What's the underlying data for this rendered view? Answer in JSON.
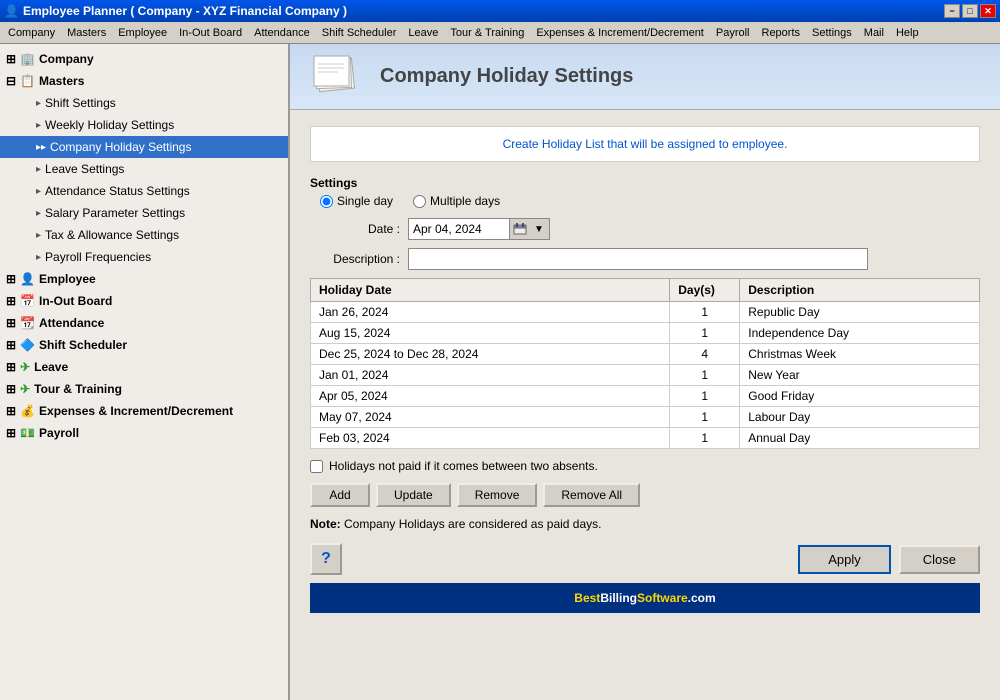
{
  "titleBar": {
    "title": "Employee Planner ( Company - XYZ Financial Company )",
    "minBtn": "−",
    "maxBtn": "□",
    "closeBtn": "✕"
  },
  "menuBar": {
    "items": [
      "Company",
      "Masters",
      "Employee",
      "In-Out Board",
      "Attendance",
      "Shift Scheduler",
      "Leave",
      "Tour & Training",
      "Expenses & Increment/Decrement",
      "Payroll",
      "Reports",
      "Settings",
      "Mail",
      "Help"
    ]
  },
  "sidebar": {
    "items": [
      {
        "id": "company",
        "label": "Company",
        "level": 0,
        "icon": "🏢"
      },
      {
        "id": "masters",
        "label": "Masters",
        "level": 0,
        "icon": "📋"
      },
      {
        "id": "shift-settings",
        "label": "Shift Settings",
        "level": 2,
        "icon": "▶"
      },
      {
        "id": "weekly-holiday",
        "label": "Weekly Holiday Settings",
        "level": 2,
        "icon": "▶"
      },
      {
        "id": "company-holiday",
        "label": "Company Holiday Settings",
        "level": 2,
        "icon": "▶▶",
        "active": true
      },
      {
        "id": "leave-settings",
        "label": "Leave Settings",
        "level": 2,
        "icon": "▶"
      },
      {
        "id": "attendance-status",
        "label": "Attendance Status Settings",
        "level": 2,
        "icon": "▶"
      },
      {
        "id": "salary-param",
        "label": "Salary Parameter Settings",
        "level": 2,
        "icon": "▶"
      },
      {
        "id": "tax-allowance",
        "label": "Tax & Allowance Settings",
        "level": 2,
        "icon": "▶"
      },
      {
        "id": "payroll-freq",
        "label": "Payroll Frequencies",
        "level": 2,
        "icon": "▶"
      },
      {
        "id": "employee",
        "label": "Employee",
        "level": 0,
        "icon": "👤"
      },
      {
        "id": "inout",
        "label": "In-Out Board",
        "level": 0,
        "icon": "📅"
      },
      {
        "id": "attendance",
        "label": "Attendance",
        "level": 0,
        "icon": "📆"
      },
      {
        "id": "shift-scheduler",
        "label": "Shift Scheduler",
        "level": 0,
        "icon": "🔷"
      },
      {
        "id": "leave",
        "label": "Leave",
        "level": 0,
        "icon": "✈"
      },
      {
        "id": "tour-training",
        "label": "Tour & Training",
        "level": 0,
        "icon": "✈"
      },
      {
        "id": "expenses",
        "label": "Expenses & Increment/Decrement",
        "level": 0,
        "icon": "💰"
      },
      {
        "id": "payroll",
        "label": "Payroll",
        "level": 0,
        "icon": "💵"
      }
    ]
  },
  "content": {
    "pageTitle": "Company Holiday Settings",
    "infoText": "Create Holiday List that will be assigned to employee.",
    "settings": {
      "label": "Settings",
      "options": [
        "Single day",
        "Multiple days"
      ],
      "selectedOption": "Single day"
    },
    "dateLabel": "Date :",
    "dateValue": "Apr 04, 2024",
    "descriptionLabel": "Description :",
    "descriptionPlaceholder": "",
    "tableHeaders": [
      "Holiday Date",
      "Day(s)",
      "Description"
    ],
    "tableRows": [
      {
        "date": "Jan 26, 2024",
        "days": "1",
        "description": "Republic Day"
      },
      {
        "date": "Aug 15, 2024",
        "days": "1",
        "description": "Independence Day"
      },
      {
        "date": "Dec 25, 2024 to Dec 28, 2024",
        "days": "4",
        "description": "Christmas Week"
      },
      {
        "date": "Jan 01, 2024",
        "days": "1",
        "description": "New Year"
      },
      {
        "date": "Apr 05, 2024",
        "days": "1",
        "description": "Good Friday"
      },
      {
        "date": "May 07, 2024",
        "days": "1",
        "description": "Labour Day"
      },
      {
        "date": "Feb 03, 2024",
        "days": "1",
        "description": "Annual Day"
      }
    ],
    "checkboxLabel": "Holidays not paid if it comes between two absents.",
    "buttons": {
      "add": "Add",
      "update": "Update",
      "remove": "Remove",
      "removeAll": "Remove All"
    },
    "noteLabel": "Note:",
    "noteText": "Company Holidays are considered as paid days.",
    "applyBtn": "Apply",
    "closeBtn": "Close",
    "helpIcon": "?",
    "footerText": "BestBillingSoftware.com"
  }
}
